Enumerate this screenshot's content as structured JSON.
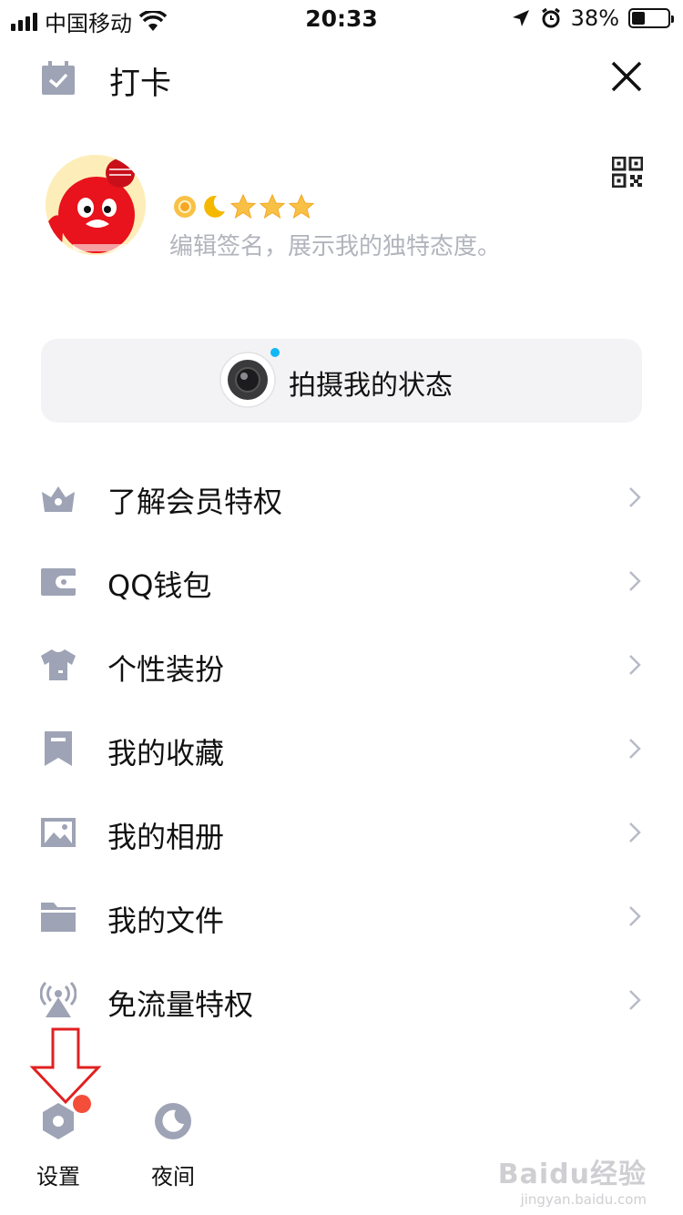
{
  "status_bar": {
    "carrier": "中国移动",
    "time": "20:33",
    "battery": "38%",
    "battery_level": 0.38,
    "icons": [
      "signal-icon",
      "wifi-icon",
      "location-icon",
      "alarm-icon",
      "battery-icon"
    ]
  },
  "header": {
    "title": "打卡",
    "icon": "calendar-check-icon",
    "close_icon": "close-icon"
  },
  "profile": {
    "level_icons": [
      "sun-icon",
      "moon-icon",
      "star-icon",
      "star-icon",
      "star-icon"
    ],
    "signature_placeholder": "编辑签名，展示我的独特态度。",
    "qr_icon": "qr-code-icon"
  },
  "shoot": {
    "label": "拍摄我的状态",
    "icon": "camera-icon"
  },
  "menu": {
    "items": [
      {
        "label": "了解会员特权",
        "icon": "crown-icon"
      },
      {
        "label": "QQ钱包",
        "icon": "wallet-icon"
      },
      {
        "label": "个性装扮",
        "icon": "tshirt-icon"
      },
      {
        "label": "我的收藏",
        "icon": "bookmark-icon"
      },
      {
        "label": "我的相册",
        "icon": "photo-icon"
      },
      {
        "label": "我的文件",
        "icon": "folder-icon"
      },
      {
        "label": "免流量特权",
        "icon": "antenna-icon"
      }
    ]
  },
  "bottom": {
    "settings_label": "设置",
    "night_label": "夜间"
  },
  "watermark": {
    "line1": "Baidu经验",
    "line2": "jingyan.baidu.com"
  },
  "colors": {
    "icon_gray": "#9ea3b5",
    "accent_blue": "#12b7f5",
    "badge_red": "#f44d3a",
    "annotation_red": "#e02020"
  }
}
